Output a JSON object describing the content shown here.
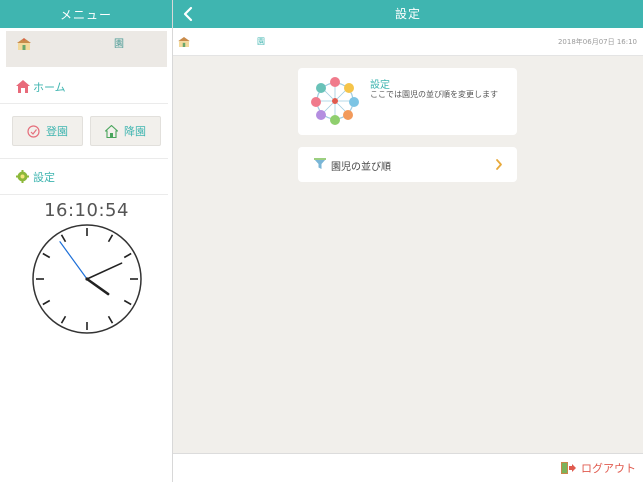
{
  "sidebar": {
    "header_title": "メニュー",
    "school_name": "園",
    "home_label": "ホーム",
    "check_in_label": "登園",
    "check_out_label": "降園",
    "settings_label": "設定",
    "digital_time": "16:10:54",
    "clock": {
      "hours": 16,
      "minutes": 10,
      "seconds": 54
    }
  },
  "header": {
    "title": "設定",
    "back_icon": "chevron-left-icon"
  },
  "sub_bar": {
    "school_name": "園",
    "datetime": "2018年06月07日 16:10"
  },
  "info_card": {
    "title": "設定",
    "description": "ここでは園児の並び順を変更します",
    "illustration": "ferris-wheel-icon"
  },
  "sort_card": {
    "label": "園児の並び順",
    "icon": "funnel-icon",
    "chevron": "chevron-right-icon"
  },
  "footer": {
    "logout_label": "ログアウト",
    "icon": "logout-door-icon"
  },
  "colors": {
    "accent": "#3fb5b0",
    "logout": "#e05a4e",
    "chevron": "#e8a93a",
    "background": "#f1efeb"
  }
}
